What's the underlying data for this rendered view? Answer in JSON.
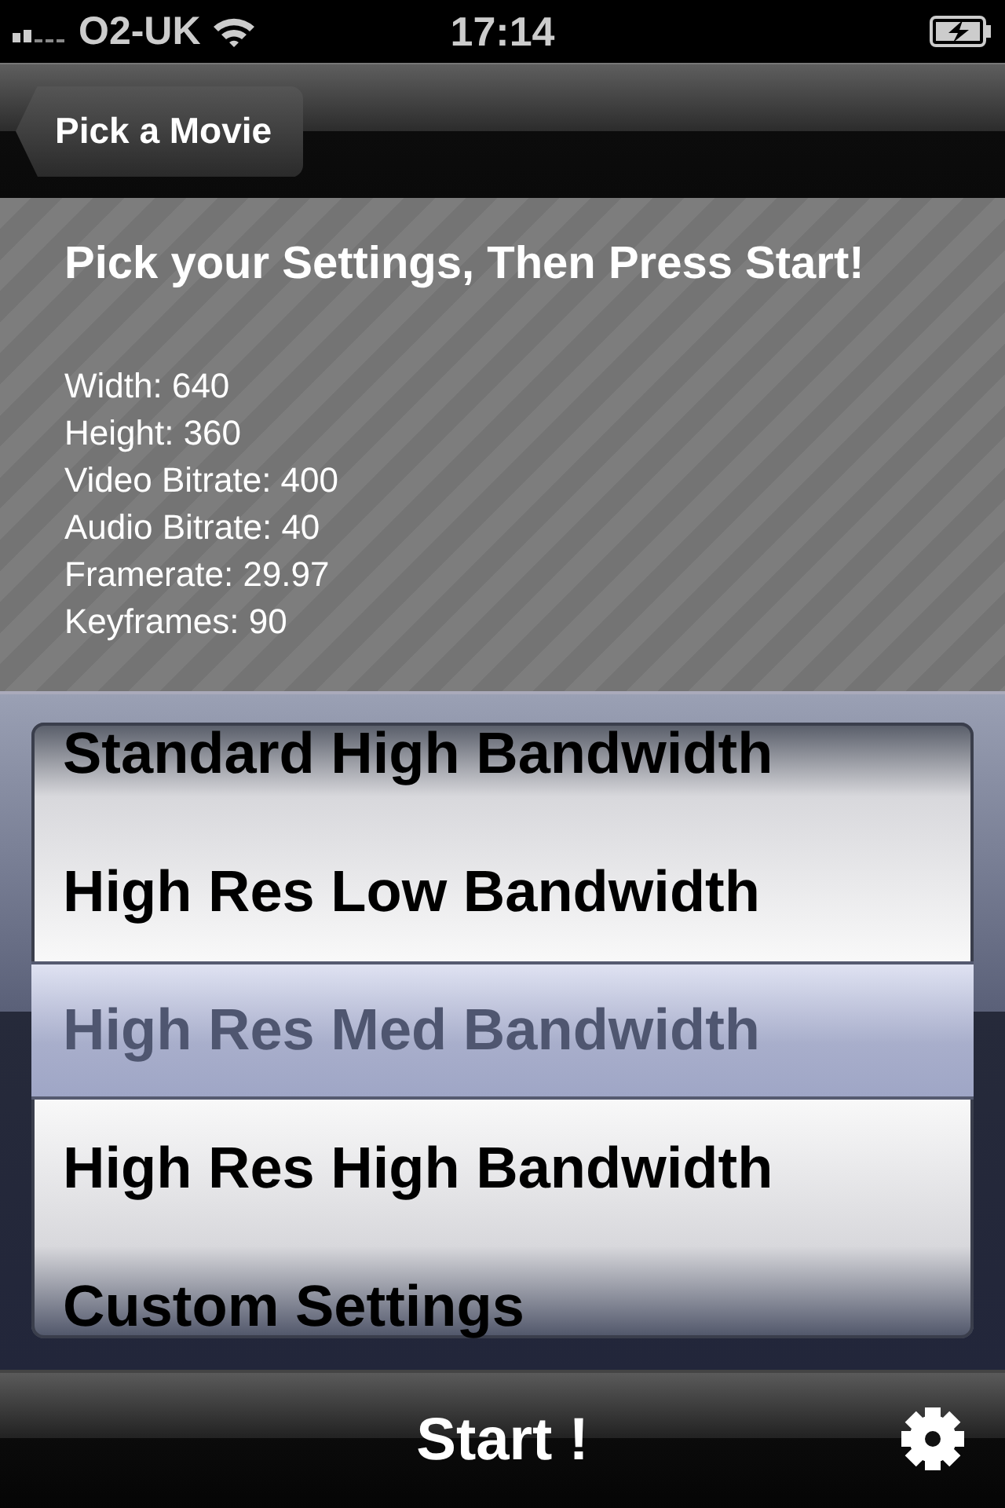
{
  "status_bar": {
    "carrier": "O2-UK",
    "time": "17:14"
  },
  "nav_bar": {
    "back_button": "Pick a Movie"
  },
  "settings_panel": {
    "title": "Pick your Settings, Then Press Start!",
    "details": [
      "Width: 640",
      "Height: 360",
      "Video Bitrate: 400",
      "Audio Bitrate: 40",
      "Framerate: 29.97",
      "Keyframes: 90"
    ]
  },
  "picker": {
    "options": [
      {
        "label": "Standard High Bandwidth",
        "selected": false
      },
      {
        "label": "High Res Low Bandwidth",
        "selected": false
      },
      {
        "label": "High Res Med Bandwidth",
        "selected": true
      },
      {
        "label": "High Res High Bandwidth",
        "selected": false
      },
      {
        "label": "Custom Settings",
        "selected": false
      }
    ]
  },
  "toolbar": {
    "start_button": "Start !"
  }
}
